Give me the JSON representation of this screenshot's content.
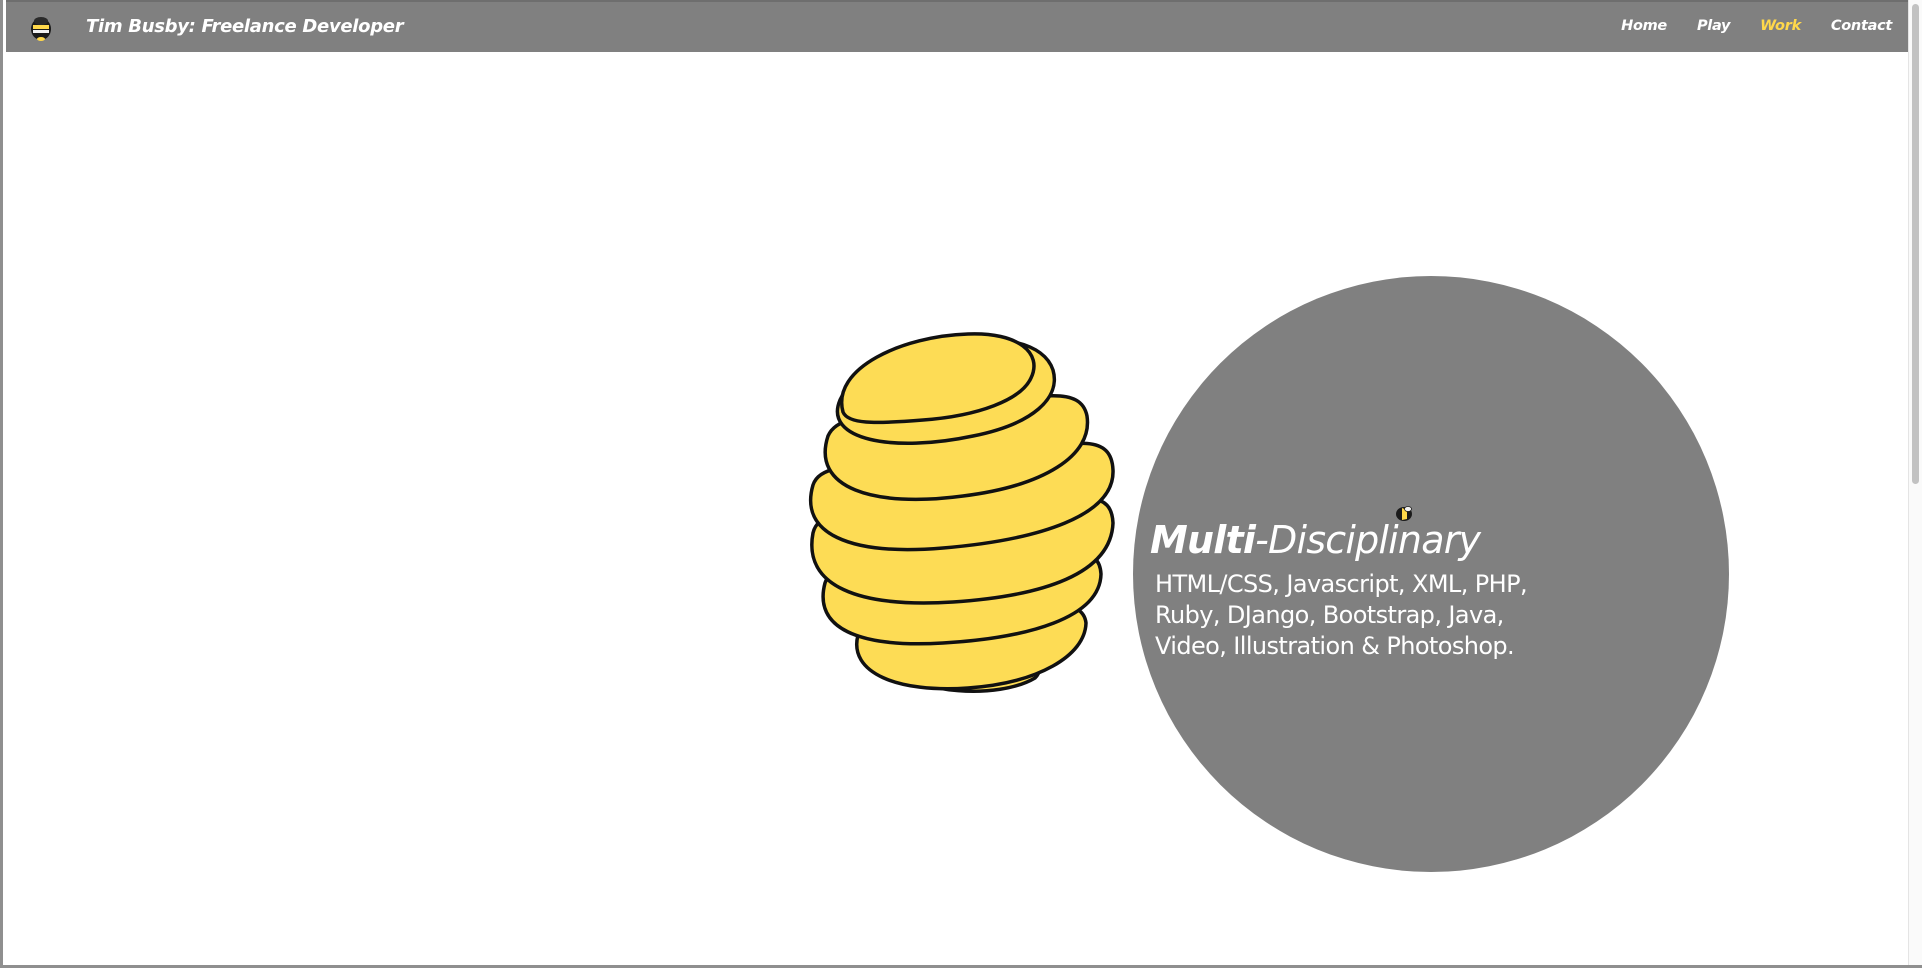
{
  "header": {
    "site_title": "Tim Busby: Freelance Developer",
    "nav": [
      {
        "label": "Home",
        "active": false
      },
      {
        "label": "Play",
        "active": false
      },
      {
        "label": "Work",
        "active": true
      },
      {
        "label": "Contact",
        "active": false
      }
    ]
  },
  "hero": {
    "headline_strong": "Multi",
    "headline_dash": "-",
    "headline_light": "Disciplinary",
    "skills_lines": [
      "HTML/CSS, Javascript, XML, PHP,",
      "Ruby, DJango, Bootstrap, Java,",
      "Video, Illustration & Photoshop."
    ]
  },
  "icons": {
    "logo": "bee-avatar-icon",
    "hive": "beehive-icon",
    "bee": "bee-icon"
  },
  "colors": {
    "navbar": "#808080",
    "active_nav": "#ffd84a",
    "hive_fill": "#fddc55",
    "circle": "#808080",
    "text": "#ffffff"
  }
}
